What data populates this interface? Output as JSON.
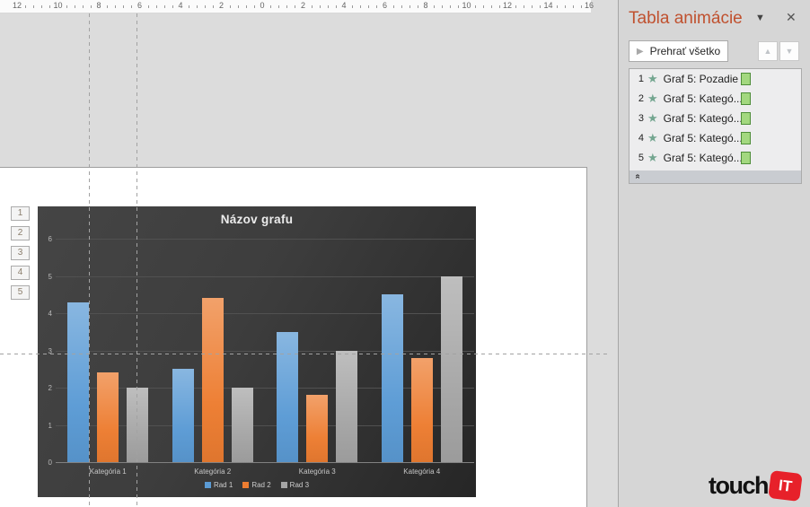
{
  "ruler": {
    "labels": [
      "12",
      "10",
      "8",
      "6",
      "4",
      "2",
      "0",
      "2",
      "4",
      "6",
      "8",
      "10",
      "12",
      "14",
      "16"
    ]
  },
  "guides": {
    "vertical_x": [
      99,
      152
    ],
    "horizontal_y": 394,
    "horizontal_width": 676
  },
  "slide_tags": [
    "1",
    "2",
    "3",
    "4",
    "5"
  ],
  "chart_data": {
    "type": "bar",
    "title": "Názov grafu",
    "categories": [
      "Kategória 1",
      "Kategória 2",
      "Kategória 3",
      "Kategória 4"
    ],
    "series": [
      {
        "name": "Rad 1",
        "color": "#5b9bd5",
        "values": [
          4.3,
          2.5,
          3.5,
          4.5
        ]
      },
      {
        "name": "Rad 2",
        "color": "#ed7d31",
        "values": [
          2.4,
          4.4,
          1.8,
          2.8
        ]
      },
      {
        "name": "Rad 3",
        "color": "#a5a5a5",
        "values": [
          2.0,
          2.0,
          3.0,
          5.0
        ]
      }
    ],
    "ylim": [
      0,
      6
    ],
    "yticks": [
      0,
      1,
      2,
      3,
      4,
      5,
      6
    ],
    "xlabel": "",
    "ylabel": "",
    "grid": true,
    "legend_position": "bottom",
    "background": "dark"
  },
  "animation_pane": {
    "title": "Tabla animácie",
    "accent_color": "#c0512f",
    "play_button_label": "Prehrať všetko",
    "items": [
      {
        "num": "1",
        "label": "Graf 5: Pozadie"
      },
      {
        "num": "2",
        "label": "Graf 5: Kategó..."
      },
      {
        "num": "3",
        "label": "Graf 5: Kategó..."
      },
      {
        "num": "4",
        "label": "Graf 5: Kategó..."
      },
      {
        "num": "5",
        "label": "Graf 5: Kategó..."
      }
    ],
    "star_color": "#74a690",
    "timeline_bar_fill": "#a3d87f",
    "timeline_bar_border": "#4e8e38"
  },
  "logo": {
    "text": "touch",
    "badge": "IT"
  }
}
